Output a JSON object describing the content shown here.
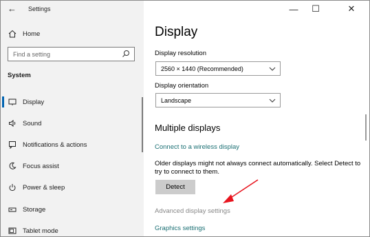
{
  "window": {
    "title": "Settings",
    "back_glyph": "←",
    "controls": {
      "minimize": "—",
      "maximize": "☐",
      "close": "✕"
    }
  },
  "sidebar": {
    "home_label": "Home",
    "search_placeholder": "Find a setting",
    "section_label": "System",
    "items": [
      {
        "label": "Display",
        "icon": "monitor-icon",
        "active": true
      },
      {
        "label": "Sound",
        "icon": "speaker-icon"
      },
      {
        "label": "Notifications & actions",
        "icon": "notification-icon"
      },
      {
        "label": "Focus assist",
        "icon": "moon-icon"
      },
      {
        "label": "Power & sleep",
        "icon": "power-icon"
      },
      {
        "label": "Storage",
        "icon": "storage-icon"
      },
      {
        "label": "Tablet mode",
        "icon": "tablet-icon"
      }
    ]
  },
  "main": {
    "title": "Display",
    "resolution": {
      "label": "Display resolution",
      "value": "2560 × 1440 (Recommended)"
    },
    "orientation": {
      "label": "Display orientation",
      "value": "Landscape"
    },
    "multiple_displays": {
      "heading": "Multiple displays",
      "wireless_link": "Connect to a wireless display",
      "description": "Older displays might not always connect automatically. Select Detect to try to connect to them.",
      "detect_button": "Detect",
      "advanced_link": "Advanced display settings",
      "graphics_link": "Graphics settings"
    }
  },
  "colors": {
    "accent": "#0063b1",
    "link": "#1a6f73",
    "annotation_arrow": "#e8141e"
  }
}
